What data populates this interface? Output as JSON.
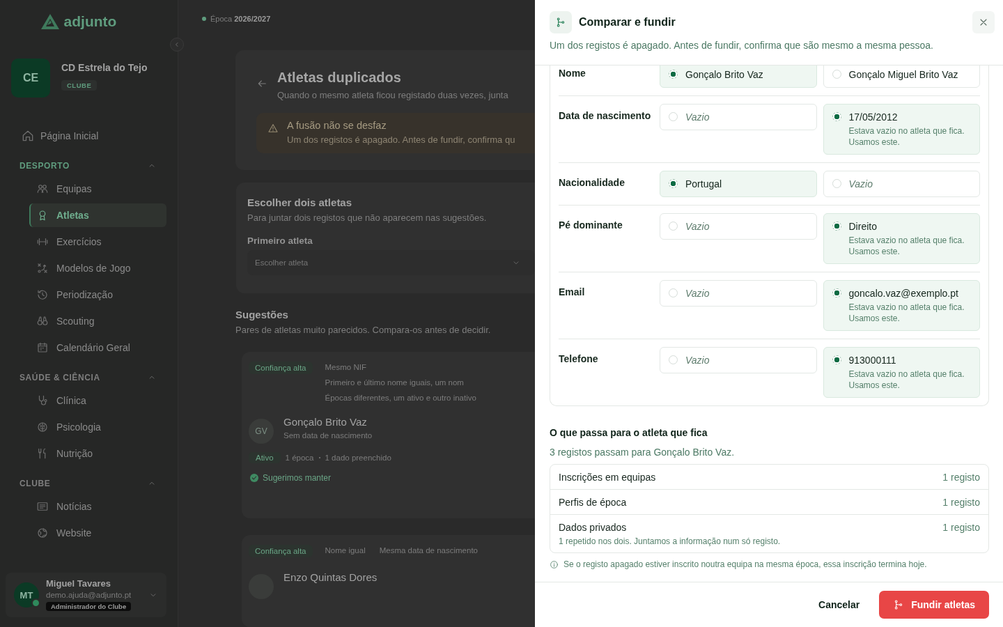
{
  "logo": {
    "name": "adjunto"
  },
  "season": {
    "label": "Época",
    "value": "2026/2027"
  },
  "club": {
    "initials": "CE",
    "name": "CD Estrela do Tejo",
    "type": "CLUBE"
  },
  "nav": {
    "home": {
      "label": "Página Inicial",
      "selected": false
    },
    "sections": [
      {
        "title": "DESPORTO",
        "expanded": true,
        "items": [
          {
            "label": "Equipas",
            "selected": false
          },
          {
            "label": "Atletas",
            "selected": true
          },
          {
            "label": "Exercícios",
            "selected": false
          },
          {
            "label": "Modelos de Jogo",
            "selected": false
          },
          {
            "label": "Periodização",
            "selected": false
          },
          {
            "label": "Scouting",
            "selected": false
          },
          {
            "label": "Calendário Geral",
            "selected": false
          }
        ]
      },
      {
        "title": "SAÚDE & CIÊNCIA",
        "expanded": true,
        "items": [
          {
            "label": "Clínica",
            "selected": false
          },
          {
            "label": "Psicologia",
            "selected": false
          },
          {
            "label": "Nutrição",
            "selected": false
          }
        ]
      },
      {
        "title": "CLUBE",
        "expanded": true,
        "items": [
          {
            "label": "Notícias",
            "selected": false
          },
          {
            "label": "Website",
            "selected": false
          }
        ]
      }
    ]
  },
  "user": {
    "initials": "MT",
    "name": "Miguel Tavares",
    "email": "demo.ajuda@adjunto.pt",
    "role": "Administrador do Clube",
    "online": true
  },
  "page": {
    "title": "Atletas duplicados",
    "subtitle": "Quando o mesmo atleta ficou registado duas vezes, junta",
    "warning": {
      "title": "A fusão não se desfaz",
      "text": "Um dos registos é apagado. Antes de fundir, confirma qu"
    },
    "picker": {
      "title": "Escolher dois atletas",
      "subtitle": "Para juntar dois registos que não aparecem nas sugestões.",
      "label": "Primeiro atleta",
      "placeholder": "Escolher atleta"
    },
    "suggestions": {
      "title": "Sugestões",
      "subtitle": "Pares de atletas muito parecidos. Compara-os antes de decidir.",
      "items": [
        {
          "confidence": "Confiança alta",
          "reasons": [
            "Mesmo NIF",
            "Primeiro e último nome iguais, um nom",
            "Épocas diferentes, um ativo e outro inativo"
          ],
          "athlete": {
            "initials": "GV",
            "name": "Gonçalo Brito Vaz",
            "detail": "Sem data de nascimento",
            "status": "Ativo",
            "meta": [
              "1 época",
              "1 dado preenchido"
            ],
            "recommended": true,
            "recommendation": "Sugerimos manter"
          }
        },
        {
          "confidence": "Confiança alta",
          "reasons": [
            "Nome igual",
            "Mesma data de nascimento"
          ],
          "athlete": {
            "name": "Enzo Quintas Dores"
          }
        }
      ]
    }
  },
  "drawer": {
    "title": "Comparar e fundir",
    "subtitle": "Um dos registos é apagado. Antes de fundir, confirma que são mesmo a mesma pessoa.",
    "fields": [
      {
        "label": "Nome",
        "options": [
          {
            "value": "Gonçalo Brito Vaz",
            "selected": true,
            "empty": false
          },
          {
            "value": "Gonçalo Miguel Brito Vaz",
            "selected": false,
            "empty": false
          }
        ]
      },
      {
        "label": "Data de nascimento",
        "options": [
          {
            "value": "Vazio",
            "selected": false,
            "empty": true
          },
          {
            "value": "17/05/2012",
            "selected": true,
            "empty": false,
            "note": "Estava vazio no atleta que fica. Usamos este."
          }
        ]
      },
      {
        "label": "Nacionalidade",
        "options": [
          {
            "value": "Portugal",
            "selected": true,
            "empty": false
          },
          {
            "value": "Vazio",
            "selected": false,
            "empty": true
          }
        ]
      },
      {
        "label": "Pé dominante",
        "options": [
          {
            "value": "Vazio",
            "selected": false,
            "empty": true
          },
          {
            "value": "Direito",
            "selected": true,
            "empty": false,
            "note": "Estava vazio no atleta que fica. Usamos este."
          }
        ]
      },
      {
        "label": "Email",
        "options": [
          {
            "value": "Vazio",
            "selected": false,
            "empty": true
          },
          {
            "value": "goncalo.vaz@exemplo.pt",
            "selected": true,
            "empty": false,
            "note": "Estava vazio no atleta que fica. Usamos este."
          }
        ]
      },
      {
        "label": "Telefone",
        "options": [
          {
            "value": "Vazio",
            "selected": false,
            "empty": true
          },
          {
            "value": "913000111",
            "selected": true,
            "empty": false,
            "note": "Estava vazio no atleta que fica. Usamos este."
          }
        ]
      }
    ],
    "transfer": {
      "title": "O que passa para o atleta que fica",
      "summary": "3 registos passam para Gonçalo Brito Vaz.",
      "items": [
        {
          "label": "Inscrições em equipas",
          "count": "1 registo"
        },
        {
          "label": "Perfis de época",
          "count": "1 registo"
        },
        {
          "label": "Dados privados",
          "count": "1 registo",
          "note": "1 repetido nos dois. Juntamos a informação num só registo."
        }
      ]
    },
    "notice": "Se o registo apagado estiver inscrito noutra equipa na mesma época, essa inscrição termina hoje.",
    "actions": {
      "cancel": "Cancelar",
      "confirm": "Fundir atletas"
    }
  }
}
